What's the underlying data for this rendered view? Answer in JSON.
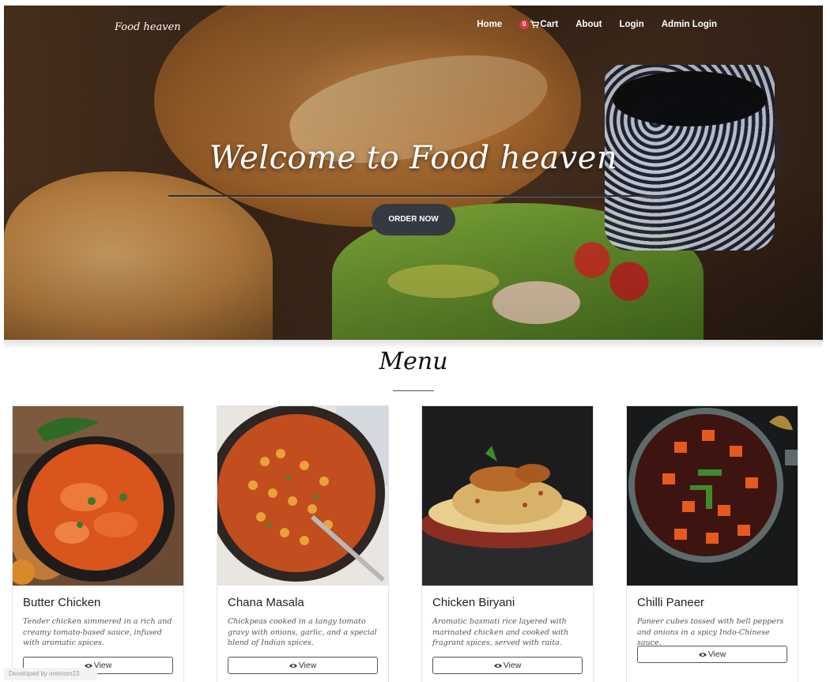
{
  "nav": {
    "brand": "Food heaven",
    "links": {
      "home": "Home",
      "cart_count": "0",
      "cart": "Cart",
      "about": "About",
      "login": "Login",
      "admin_login": "Admin Login"
    }
  },
  "hero": {
    "title": "Welcome to Food heaven",
    "cta": "ORDER NOW"
  },
  "menu": {
    "title": "Menu",
    "items": [
      {
        "name": "Butter Chicken",
        "description": "Tender chicken simmered in a rich and creamy tomato-based sauce, infused with aromatic spices.",
        "button": "View"
      },
      {
        "name": "Chana Masala",
        "description": "Chickpeas cooked in a tangy tomato gravy with onions, garlic, and a special blend of Indian spices.",
        "button": "View"
      },
      {
        "name": "Chicken Biryani",
        "description": "Aromatic basmati rice layered with marinated chicken and cooked with fragrant spices, served with raita.",
        "button": "View"
      },
      {
        "name": "Chilli Paneer",
        "description": "Paneer cubes tossed with bell peppers and onions in a spicy Indo-Chinese sauce.",
        "button": "View"
      }
    ]
  },
  "footer": {
    "credit": "Developed by oretnom23"
  },
  "icons": {
    "cart": "cart-icon",
    "view": "eye-icon"
  },
  "colors": {
    "cta_bg": "#343a40",
    "badge": "#dc3545"
  }
}
